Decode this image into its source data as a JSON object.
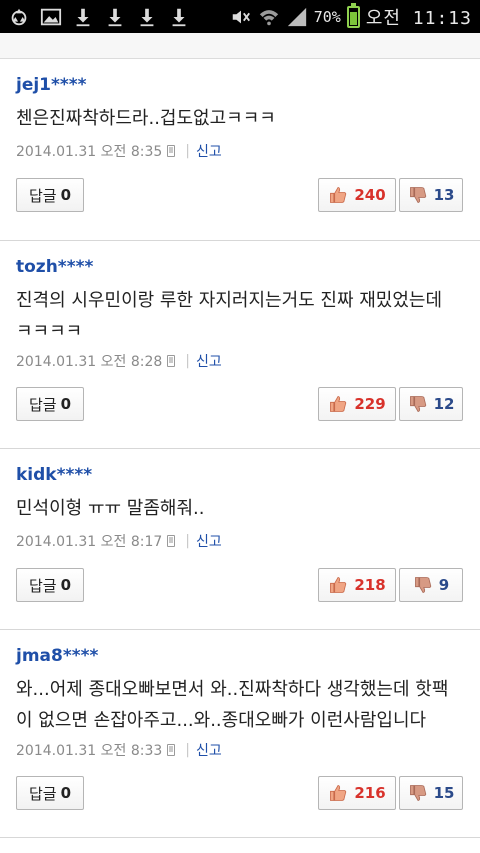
{
  "status_bar": {
    "battery_text": "70%",
    "time_text": "오전 11:13",
    "battery_level": 0.7,
    "left_icons": [
      "recycle-icon",
      "image-icon",
      "download-icon",
      "download-icon",
      "download-icon",
      "download-icon"
    ],
    "right_icons": [
      "mute-icon",
      "wifi-icon",
      "signal-icon",
      "battery-icon"
    ]
  },
  "colors": {
    "username": "#1f4fa8",
    "like": "#d8322b",
    "dislike": "#2b4a8a",
    "thumb_up_fill": "#f0a584",
    "thumb_down_fill": "#d79a84"
  },
  "comments": [
    {
      "user": "jej1****",
      "lines": [
        "첸은진짜착하드라..겁도없고ㅋㅋㅋ"
      ],
      "date": "2014.01.31 오전 8:35",
      "report": "신고",
      "reply_label": "답글",
      "reply_count": "0",
      "likes": "240",
      "dislikes": "13"
    },
    {
      "user": "tozh****",
      "lines": [
        "진격의 시우민이랑 루한 자지러지는거도 진짜 재밌었는데",
        "ㅋㅋㅋㅋ"
      ],
      "date": "2014.01.31 오전 8:28",
      "report": "신고",
      "reply_label": "답글",
      "reply_count": "0",
      "likes": "229",
      "dislikes": "12"
    },
    {
      "user": "kidk****",
      "lines": [
        "민석이형 ㅠㅠ 말좀해줘.."
      ],
      "date": "2014.01.31 오전 8:17",
      "report": "신고",
      "reply_label": "답글",
      "reply_count": "0",
      "likes": "218",
      "dislikes": "9"
    },
    {
      "user": "jma8****",
      "lines": [
        "와...어제 종대오빠보면서 와..진짜착하다 생각했는데 핫팩",
        "이 없으면 손잡아주고...와..종대오빠가 이런사람입니다"
      ],
      "date": "2014.01.31 오전 8:33",
      "report": "신고",
      "reply_label": "답글",
      "reply_count": "0",
      "likes": "216",
      "dislikes": "15"
    }
  ]
}
